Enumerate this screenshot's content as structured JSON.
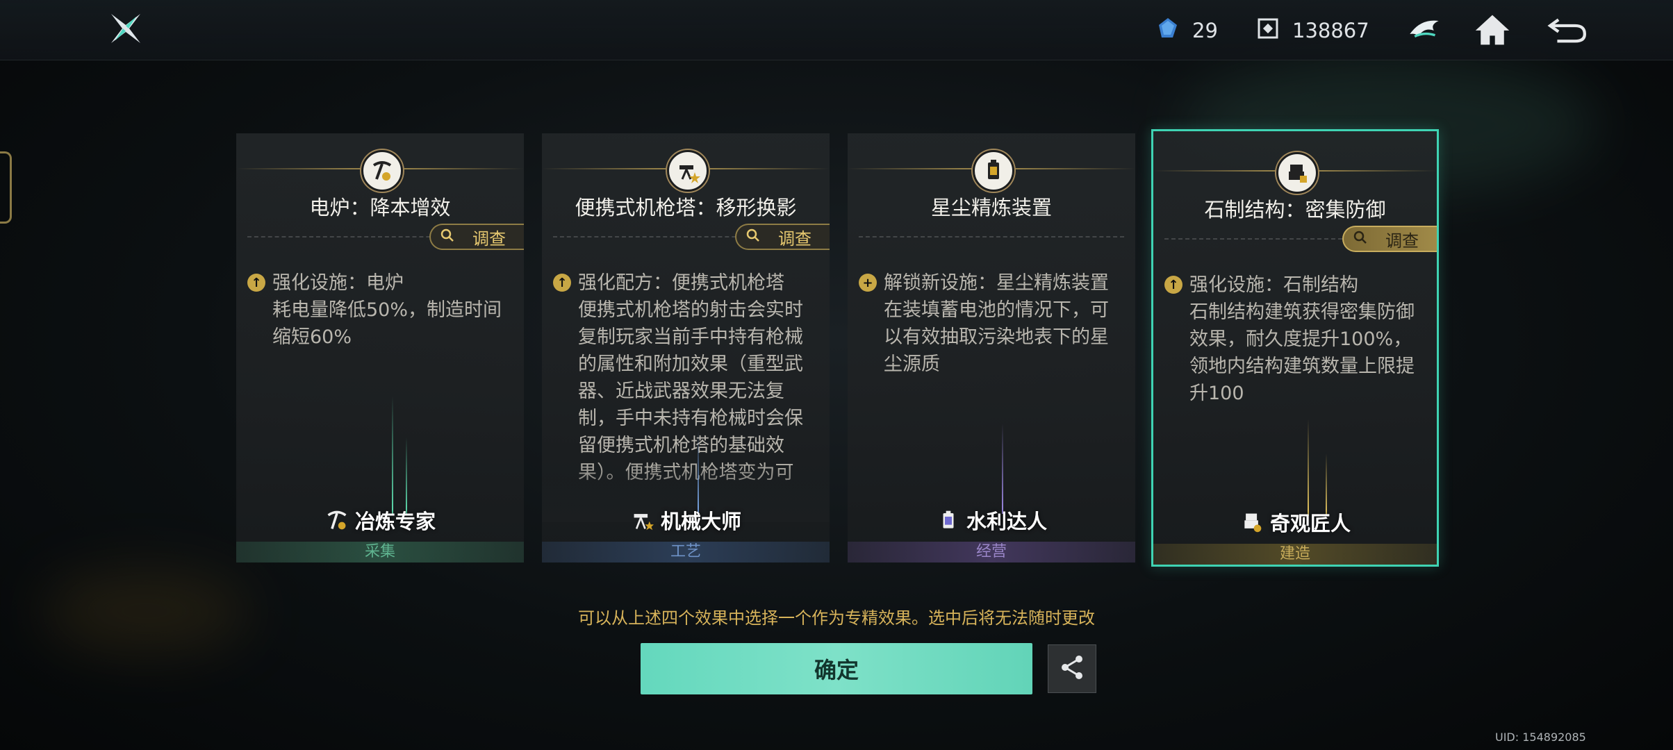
{
  "header": {
    "logo_icon": "shuriken-logo-icon",
    "currencies": [
      {
        "icon": "stardust-crystal-icon",
        "value": "29"
      },
      {
        "icon": "cube-token-icon",
        "value": "138867"
      }
    ],
    "buttons": [
      "bird-emblem-icon",
      "home-icon",
      "back-arrow-icon"
    ]
  },
  "cards": [
    {
      "title": "电炉：降本增效",
      "investigate": "调查",
      "bullet": "up",
      "lines": [
        "强化设施：电炉",
        "耗电量降低50%，制造时间缩短60%"
      ],
      "role": "冶炼专家",
      "category": "采集",
      "accent": "#3a7a5e",
      "beam": "#5fe0b0"
    },
    {
      "title": "便携式机枪塔：移形换影",
      "investigate": "调查",
      "bullet": "up",
      "lines": [
        "强化配方：便携式机枪塔",
        "便携式机枪塔的射击会实时复制玩家当前手中持有枪械的属性和附加效果（重型武器、近战武器效果无法复制，手中未持有枪械时会保留便携式机枪塔的基础效果）。便携式机枪塔变为可"
      ],
      "role": "机械大师",
      "category": "工艺",
      "accent": "#3c5a86",
      "beam": "#7aa8e8"
    },
    {
      "title": "星尘精炼装置",
      "investigate": "",
      "bullet": "plus",
      "lines": [
        "解锁新设施：星尘精炼装置",
        "在装填蓄电池的情况下，可以有效抽取污染地表下的星尘源质"
      ],
      "role": "水利达人",
      "category": "经营",
      "accent": "#5e4a86",
      "beam": "#a08ae8"
    },
    {
      "title": "石制结构：密集防御",
      "investigate": "调查",
      "bullet": "up",
      "lines": [
        "强化设施：石制结构",
        "石制结构建筑获得密集防御效果，耐久度提升100%，领地内结构建筑数量上限提升100"
      ],
      "role": "奇观匠人",
      "category": "建造",
      "accent": "#7a6a2e",
      "beam": "#e8c860",
      "selected": true
    }
  ],
  "notice": "可以从上述四个效果中选择一个作为专精效果。选中后将无法随时更改",
  "confirm_label": "确定",
  "uid": "UID: 154892085"
}
